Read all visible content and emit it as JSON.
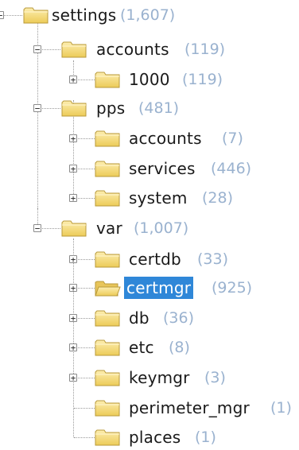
{
  "tree": {
    "nodes": [
      {
        "label": "settings",
        "count": "(1,607)",
        "expanded": true,
        "icon": "folder-icon"
      },
      {
        "label": "accounts",
        "count": "(119)",
        "expanded": true,
        "icon": "folder-icon"
      },
      {
        "label": "1000",
        "count": "(119)",
        "expanded": false,
        "icon": "folder-icon"
      },
      {
        "label": "pps",
        "count": "(481)",
        "expanded": true,
        "icon": "folder-icon"
      },
      {
        "label": "accounts",
        "count": "(7)",
        "expanded": false,
        "icon": "folder-icon"
      },
      {
        "label": "services",
        "count": "(446)",
        "expanded": false,
        "icon": "folder-icon"
      },
      {
        "label": "system",
        "count": "(28)",
        "expanded": false,
        "icon": "folder-icon"
      },
      {
        "label": "var",
        "count": "(1,007)",
        "expanded": true,
        "icon": "folder-icon"
      },
      {
        "label": "certdb",
        "count": "(33)",
        "expanded": false,
        "icon": "folder-icon"
      },
      {
        "label": "certmgr",
        "count": "(925)",
        "expanded": false,
        "selected": true,
        "icon": "open-folder-icon"
      },
      {
        "label": "db",
        "count": "(36)",
        "expanded": false,
        "icon": "folder-icon"
      },
      {
        "label": "etc",
        "count": "(8)",
        "expanded": false,
        "icon": "folder-icon"
      },
      {
        "label": "keymgr",
        "count": "(3)",
        "expanded": false,
        "icon": "folder-icon"
      },
      {
        "label": "perimeter_mgr",
        "count": "(1)",
        "icon": "folder-icon"
      },
      {
        "label": "places",
        "count": "(1)",
        "icon": "folder-icon"
      }
    ],
    "signs": {
      "collapse": "−",
      "expand": "+"
    },
    "colors": {
      "selection": "#2f87d8",
      "count_text": "#9ab2cf",
      "folder": "#f5d978"
    }
  }
}
